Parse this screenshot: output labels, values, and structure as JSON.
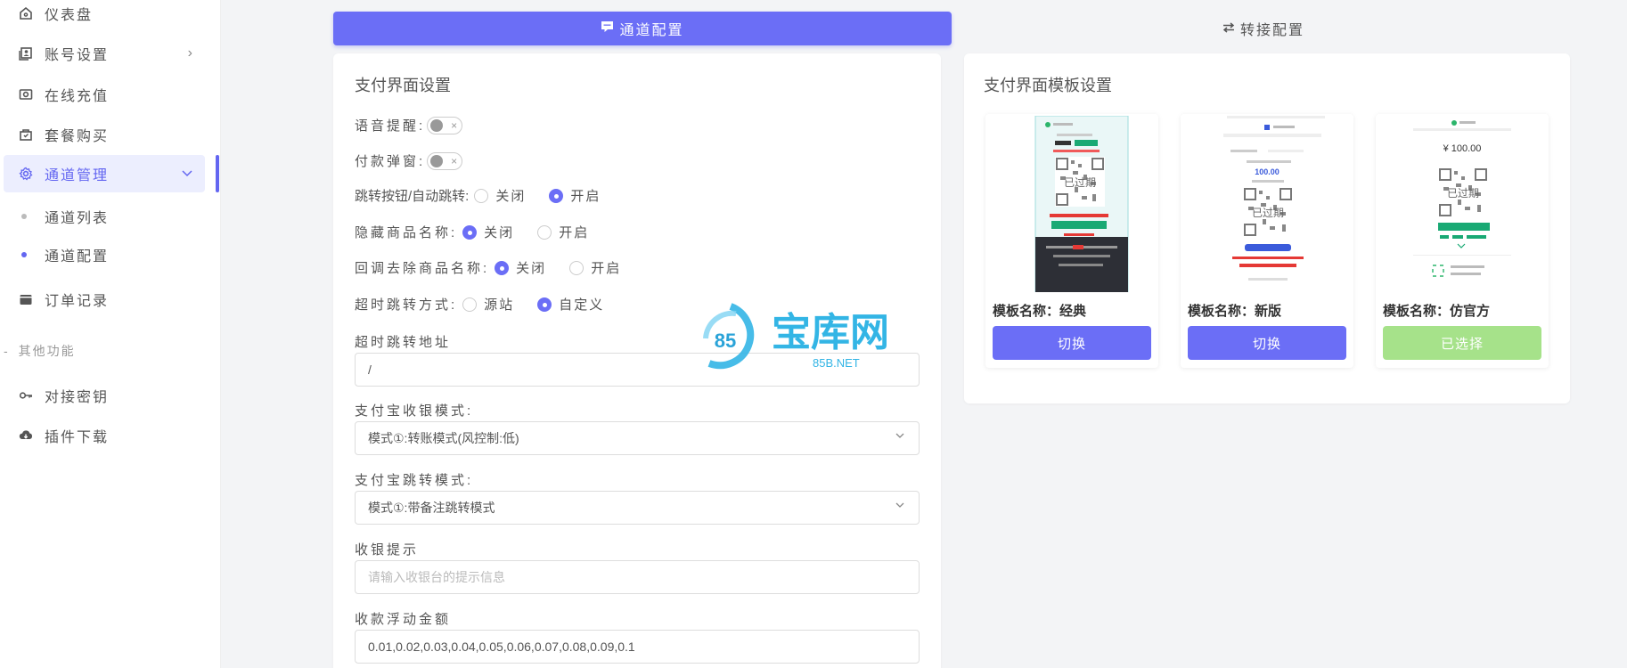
{
  "sidebar": {
    "items": [
      {
        "label": "仪表盘",
        "icon": "home-icon"
      },
      {
        "label": "账号设置",
        "icon": "user-card-icon",
        "chevron": "›"
      },
      {
        "label": "在线充值",
        "icon": "camera-icon"
      },
      {
        "label": "套餐购买",
        "icon": "bag-icon"
      },
      {
        "label": "通道管理",
        "icon": "gear-icon",
        "chevron": "⌄"
      },
      {
        "label": "订单记录",
        "icon": "wallet-icon"
      }
    ],
    "sub_items": [
      {
        "label": "通道列表"
      },
      {
        "label": "通道配置"
      }
    ],
    "section_label": "其他功能",
    "other_items": [
      {
        "label": "对接密钥",
        "icon": "key-icon"
      },
      {
        "label": "插件下载",
        "icon": "cloud-download-icon"
      }
    ]
  },
  "tabs": [
    {
      "label": "通道配置",
      "icon": "chat-icon"
    },
    {
      "label": "转接配置",
      "icon": "swap-icon"
    }
  ],
  "left": {
    "title": "支付界面设置",
    "voice_label": "语音提醒:",
    "popup_label": "付款弹窗:",
    "jump_label": "跳转按钮/自动跳转:",
    "hide_label": "隐藏商品名称:",
    "callback_label": "回调去除商品名称:",
    "timeout_label": "超时跳转方式:",
    "opt_off": "关闭",
    "opt_on": "开启",
    "opt_source": "源站",
    "opt_custom": "自定义",
    "timeout_url_label": "超时跳转地址",
    "timeout_url_value": "/",
    "alipay_mode_label": "支付宝收银模式:",
    "alipay_mode_value": "模式①:转账模式(风控制:低)",
    "alipay_jump_label": "支付宝跳转模式:",
    "alipay_jump_value": "模式①:带备注跳转模式",
    "cashier_tip_label": "收银提示",
    "cashier_tip_placeholder": "请输入收银台的提示信息",
    "float_label": "收款浮动金额",
    "float_value": "0.01,0.02,0.03,0.04,0.05,0.06,0.07,0.08,0.09,0.1"
  },
  "right": {
    "title": "支付界面模板设置",
    "templates": [
      {
        "name": "模板名称：经典",
        "button": "切换",
        "selected": false
      },
      {
        "name": "模板名称：新版",
        "button": "切换",
        "selected": false
      },
      {
        "name": "模板名称：仿官方",
        "button": "已选择",
        "selected": true
      }
    ],
    "expired_text": "已过期",
    "amount_new": "100.00",
    "amount_official": "¥ 100.00"
  },
  "watermark": {
    "text": "宝库网",
    "sub": "85B.NET",
    "logo": "85"
  },
  "colors": {
    "accent": "#6b6ef6",
    "selected": "#a6e28a",
    "watermark": "#33b5e5"
  }
}
